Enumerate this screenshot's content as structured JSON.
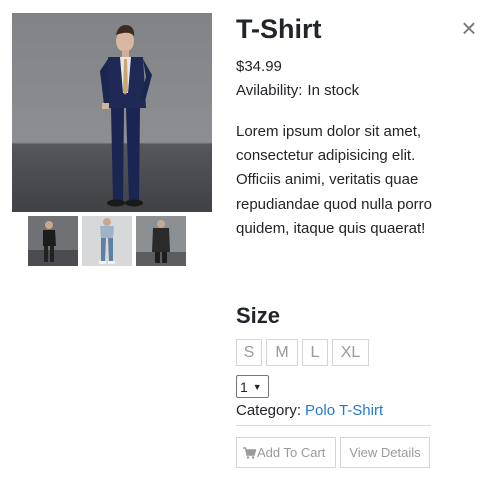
{
  "modal": {
    "close_label": "×"
  },
  "product": {
    "title": "T-Shirt",
    "price": "$34.99",
    "availability_label": "Avilability:",
    "availability_value": "In stock",
    "description": "Lorem ipsum dolor sit amet, consectetur adipisicing elit. Officiis animi, veritatis quae repudiandae quod nulla porro quidem, itaque quis quaerat!",
    "size_heading": "Size",
    "sizes": [
      "S",
      "M",
      "L",
      "XL"
    ],
    "quantity": "1",
    "category_label": "Category:",
    "category_value": "Polo T-Shirt"
  },
  "actions": {
    "add_to_cart": "Add To Cart",
    "view_details": "View Details"
  },
  "icons": {
    "close": "close-icon",
    "cart": "shopping-cart-icon",
    "dropdown": "caret-down-icon"
  },
  "colors": {
    "link": "#1f7ad6",
    "button_text": "#9a9a9a",
    "button_border": "#d5d5d5"
  }
}
